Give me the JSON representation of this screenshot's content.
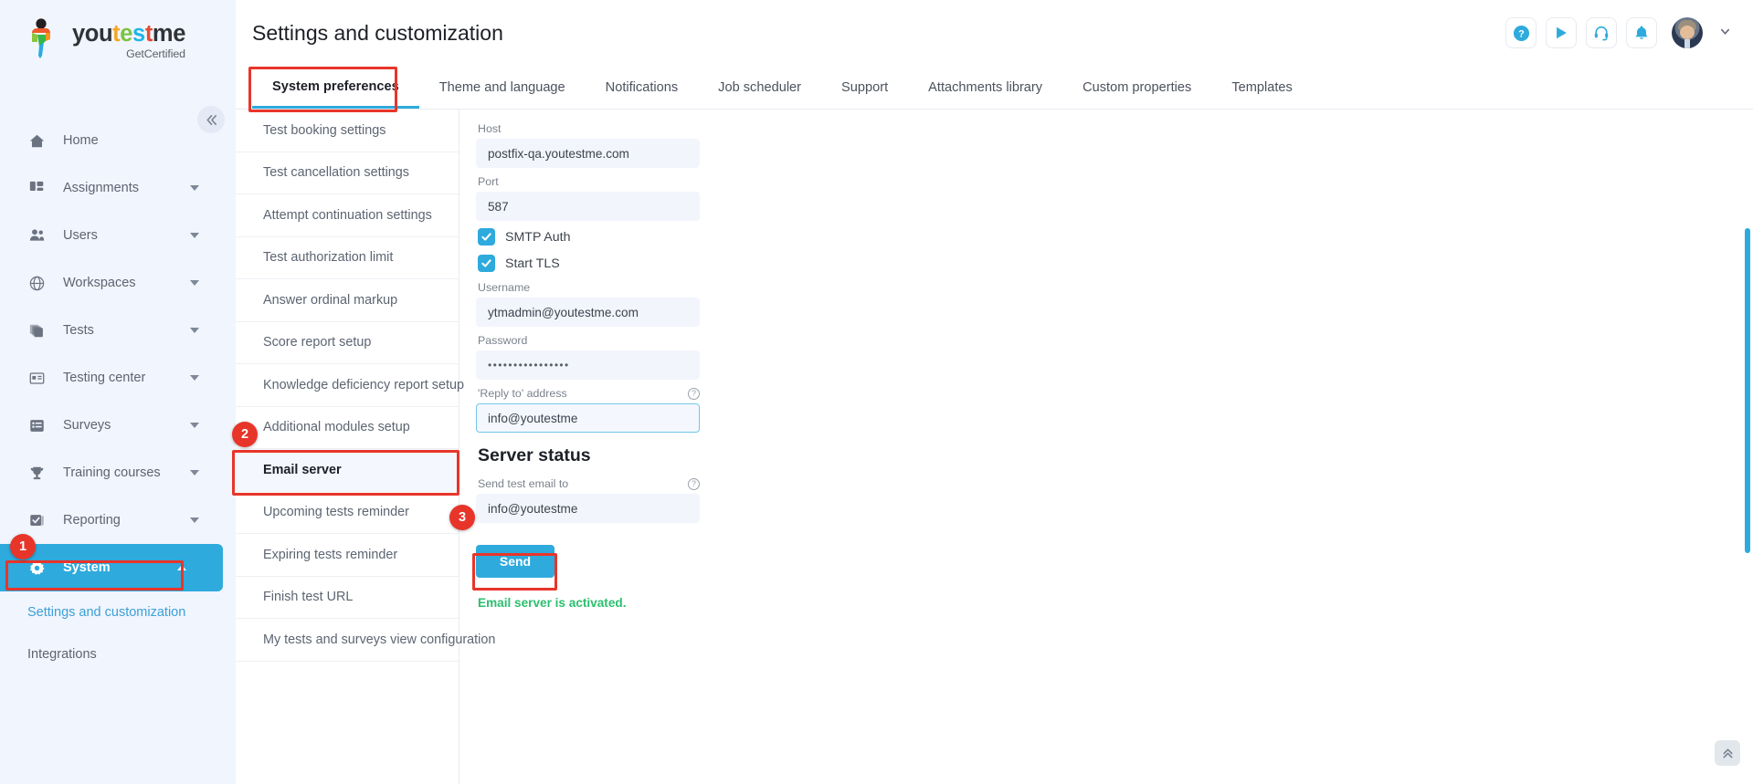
{
  "brand": {
    "word_parts": [
      "you",
      "t",
      "e",
      "s",
      "t",
      "me"
    ],
    "tagline": "GetCertified",
    "collapse_icon": "chevron-double-left-icon"
  },
  "sidebar": {
    "items": [
      {
        "label": "Home",
        "icon": "home-icon",
        "caret": false,
        "active": false
      },
      {
        "label": "Assignments",
        "icon": "assignments-icon",
        "caret": true,
        "active": false
      },
      {
        "label": "Users",
        "icon": "users-icon",
        "caret": true,
        "active": false
      },
      {
        "label": "Workspaces",
        "icon": "globe-icon",
        "caret": true,
        "active": false
      },
      {
        "label": "Tests",
        "icon": "tests-icon",
        "caret": true,
        "active": false
      },
      {
        "label": "Testing center",
        "icon": "testing-center-icon",
        "caret": true,
        "active": false
      },
      {
        "label": "Surveys",
        "icon": "surveys-icon",
        "caret": true,
        "active": false
      },
      {
        "label": "Training courses",
        "icon": "trophy-icon",
        "caret": true,
        "active": false
      },
      {
        "label": "Reporting",
        "icon": "reporting-icon",
        "caret": true,
        "active": false
      },
      {
        "label": "System",
        "icon": "gear-icon",
        "caret": true,
        "active": true
      }
    ],
    "sub_items": [
      {
        "label": "Settings and customization",
        "highlighted": true
      },
      {
        "label": "Integrations",
        "highlighted": false
      }
    ]
  },
  "header": {
    "title": "Settings and customization",
    "icons": [
      {
        "name": "help-icon",
        "glyph": "?"
      },
      {
        "name": "play-icon",
        "glyph": "▶"
      },
      {
        "name": "support-headset-icon",
        "glyph": "headset"
      },
      {
        "name": "notifications-bell-icon",
        "glyph": "bell"
      }
    ],
    "avatar_caret": "chevron-down-icon"
  },
  "tabs": [
    {
      "label": "System preferences",
      "active": true
    },
    {
      "label": "Theme and language",
      "active": false
    },
    {
      "label": "Notifications",
      "active": false
    },
    {
      "label": "Job scheduler",
      "active": false
    },
    {
      "label": "Support",
      "active": false
    },
    {
      "label": "Attachments library",
      "active": false
    },
    {
      "label": "Custom properties",
      "active": false
    },
    {
      "label": "Templates",
      "active": false
    }
  ],
  "sub_nav": [
    {
      "label": "Test booking settings",
      "selected": false
    },
    {
      "label": "Test cancellation settings",
      "selected": false
    },
    {
      "label": "Attempt continuation settings",
      "selected": false
    },
    {
      "label": "Test authorization limit",
      "selected": false
    },
    {
      "label": "Answer ordinal markup",
      "selected": false
    },
    {
      "label": "Score report setup",
      "selected": false
    },
    {
      "label": "Knowledge deficiency report setup",
      "selected": false
    },
    {
      "label": "Additional modules setup",
      "selected": false
    },
    {
      "label": "Email server",
      "selected": true
    },
    {
      "label": "Upcoming tests reminder",
      "selected": false
    },
    {
      "label": "Expiring tests reminder",
      "selected": false
    },
    {
      "label": "Finish test URL",
      "selected": false
    },
    {
      "label": "My tests and surveys view configuration",
      "selected": false
    }
  ],
  "form": {
    "host": {
      "label": "Host",
      "value": "postfix-qa.youtestme.com"
    },
    "port": {
      "label": "Port",
      "value": "587"
    },
    "smtp_auth": {
      "label": "SMTP Auth",
      "checked": true
    },
    "start_tls": {
      "label": "Start TLS",
      "checked": true
    },
    "username": {
      "label": "Username",
      "value": "ytmadmin@youtestme.com"
    },
    "password": {
      "label": "Password",
      "value": "••••••••••••••••"
    },
    "reply_to": {
      "label": "'Reply to' address",
      "value": "info@youtestme",
      "help": "?"
    }
  },
  "server_status": {
    "title": "Server status",
    "test_email": {
      "label": "Send test email to",
      "value": "info@youtestme",
      "help": "?"
    },
    "send_label": "Send",
    "status_message": "Email server is activated."
  },
  "annotations": {
    "badges": [
      {
        "number": "1",
        "target": "settings-and-customization-sidebar-link"
      },
      {
        "number": "2",
        "target": "email-server-subnav-item"
      },
      {
        "number": "3",
        "target": "send-test-email-input"
      }
    ]
  },
  "colors": {
    "accent": "#2eaadc",
    "highlight": "#e8352a",
    "success": "#2bbf6e",
    "sidebar_bg": "#f1f5fd"
  },
  "scroll": {
    "to_top_icon": "chevron-double-up-icon"
  }
}
